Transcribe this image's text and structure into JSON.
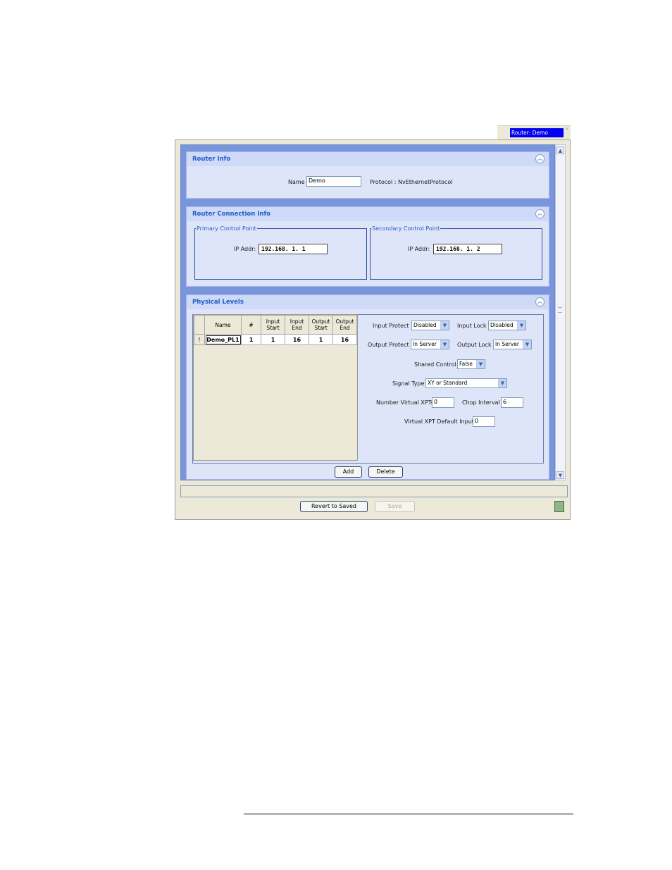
{
  "tab": {
    "label": "Router: Demo",
    "close": "×"
  },
  "router_info": {
    "title": "Router Info",
    "name_label": "Name",
    "name_value": "Demo",
    "protocol_text": "Protocol : NvEthernetProtocol"
  },
  "connection_info": {
    "title": "Router Connection Info",
    "primary": {
      "legend": "Primary Control Point",
      "ip_label": "IP Addr:",
      "ip_value": "192.168.   1.   1"
    },
    "secondary": {
      "legend": "Secondary Control Point",
      "ip_label": "IP Addr:",
      "ip_value": "192.168.   1.   2"
    }
  },
  "physical_levels": {
    "title": "Physical Levels",
    "table": {
      "columns": [
        "Name",
        "#",
        "Input Start",
        "Input End",
        "Output Start",
        "Output End"
      ],
      "rows": [
        {
          "marker": "!",
          "name": "Demo_PL1",
          "num": "1",
          "input_start": "1",
          "input_end": "16",
          "output_start": "1",
          "output_end": "16"
        }
      ]
    },
    "input_protect": {
      "label": "Input Protect",
      "value": "Disabled"
    },
    "input_lock": {
      "label": "Input Lock",
      "value": "Disabled"
    },
    "output_protect": {
      "label": "Output Protect",
      "value": "In Server"
    },
    "output_lock": {
      "label": "Output Lock",
      "value": "In Server"
    },
    "shared_control": {
      "label": "Shared Control",
      "value": "False"
    },
    "signal_type": {
      "label": "Signal Type",
      "value": "XY or Standard"
    },
    "num_virtual_xpts": {
      "label": "Number Virtual XPTs",
      "value": "0"
    },
    "chop_interval": {
      "label": "Chop Interval",
      "value": "6"
    },
    "virtual_xpt_default": {
      "label": "Virtual XPT Default Input",
      "value": "0"
    },
    "add_label": "Add",
    "delete_label": "Delete"
  },
  "footer": {
    "revert_label": "Revert to Saved",
    "save_label": "Save"
  },
  "icons": {
    "collapse": "chevron-up-double-icon",
    "dropdown": "chevron-down-icon",
    "scroll_up": "arrow-up-icon",
    "scroll_down": "arrow-down-icon",
    "help": "help-icon"
  },
  "colors": {
    "panel_bg": "#7996dc",
    "section_bg": "#dfe5f8",
    "title_blue": "#215dc6",
    "tab_highlight": "#0000ee"
  }
}
